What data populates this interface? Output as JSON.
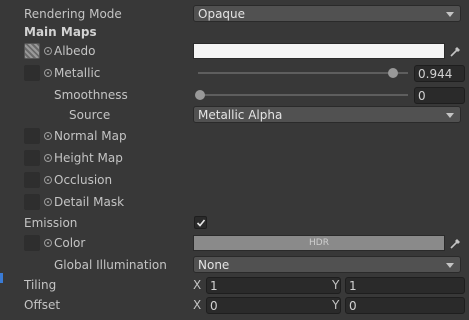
{
  "rendering_mode": {
    "label": "Rendering Mode",
    "value": "Opaque"
  },
  "main_maps": {
    "label": "Main Maps"
  },
  "albedo": {
    "label": "Albedo",
    "color": "#f4f4f4"
  },
  "metallic": {
    "label": "Metallic",
    "value": "0.944",
    "fraction": 0.944
  },
  "smoothness": {
    "label": "Smoothness",
    "value": "0",
    "fraction": 0
  },
  "source": {
    "label": "Source",
    "value": "Metallic Alpha"
  },
  "normal_map": {
    "label": "Normal Map"
  },
  "height_map": {
    "label": "Height Map"
  },
  "occlusion": {
    "label": "Occlusion"
  },
  "detail_mask": {
    "label": "Detail Mask"
  },
  "emission": {
    "label": "Emission",
    "checked": true
  },
  "emission_color": {
    "label": "Color",
    "badge": "HDR",
    "color": "#8a8a8a"
  },
  "global_illumination": {
    "label": "Global Illumination",
    "value": "None"
  },
  "tiling": {
    "label": "Tiling",
    "x_label": "X",
    "x": "1",
    "y_label": "Y",
    "y": "1"
  },
  "offset": {
    "label": "Offset",
    "x_label": "X",
    "x": "0",
    "y_label": "Y",
    "y": "0"
  }
}
